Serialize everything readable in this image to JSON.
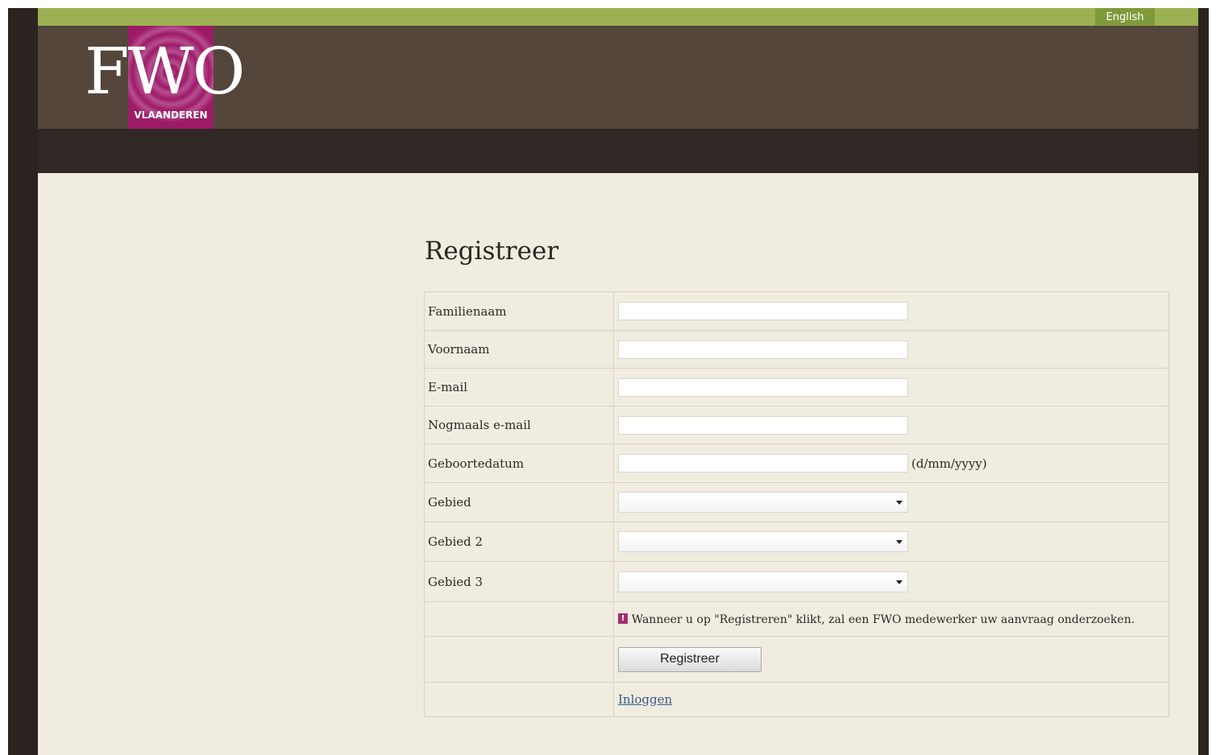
{
  "topbar": {
    "language_link": "English"
  },
  "logo": {
    "letters": "FWO",
    "sub": "VLAANDEREN"
  },
  "page": {
    "title": "Registreer"
  },
  "form": {
    "fields": [
      {
        "label": "Familienaam",
        "type": "text",
        "value": ""
      },
      {
        "label": "Voornaam",
        "type": "text",
        "value": ""
      },
      {
        "label": "E-mail",
        "type": "text",
        "value": ""
      },
      {
        "label": "Nogmaals e-mail",
        "type": "text",
        "value": ""
      },
      {
        "label": "Geboortedatum",
        "type": "text",
        "value": "",
        "hint": "(d/mm/yyyy)"
      },
      {
        "label": "Gebied",
        "type": "select",
        "selected": ""
      },
      {
        "label": "Gebied 2",
        "type": "select",
        "selected": ""
      },
      {
        "label": "Gebied 3",
        "type": "select",
        "selected": ""
      }
    ],
    "notice": "Wanneer u op \"Registreren\" klikt, zal een FWO medewerker uw aanvraag onderzoeken.",
    "notice_icon": "!",
    "submit_label": "Registreer",
    "login_link": "Inloggen"
  },
  "colors": {
    "topbar": "#9cb153",
    "header": "#54463a",
    "navbar": "#302824",
    "content_bg": "#f0ece0",
    "logo_magenta": "#9c1b67"
  }
}
